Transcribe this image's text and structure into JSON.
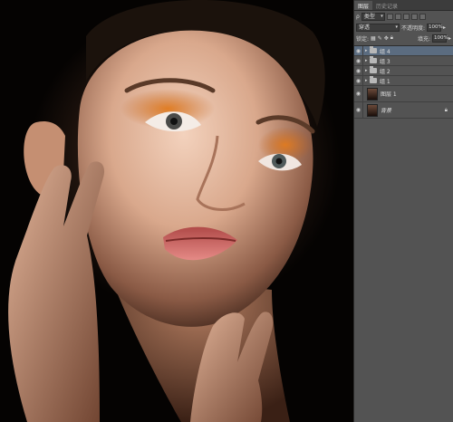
{
  "panel": {
    "tabs": [
      "图层",
      "历史记录"
    ],
    "filter_label": "类型",
    "blend_mode": "穿透",
    "opacity_label": "不透明度:",
    "opacity_value": "100%",
    "lock_label": "锁定:",
    "fill_label": "填充:",
    "fill_value": "100%"
  },
  "layers": [
    {
      "name": "组 4",
      "type": "group",
      "selected": true
    },
    {
      "name": "组 3",
      "type": "group",
      "selected": false
    },
    {
      "name": "组 2",
      "type": "group",
      "selected": false
    },
    {
      "name": "组 1",
      "type": "group",
      "selected": false
    },
    {
      "name": "图层 1",
      "type": "pixel",
      "selected": false
    },
    {
      "name": "背景",
      "type": "background",
      "selected": false
    }
  ],
  "colors": {
    "panel_bg": "#535353",
    "selected_layer": "#5b6c80",
    "eyeshadow": "#d8741c"
  }
}
